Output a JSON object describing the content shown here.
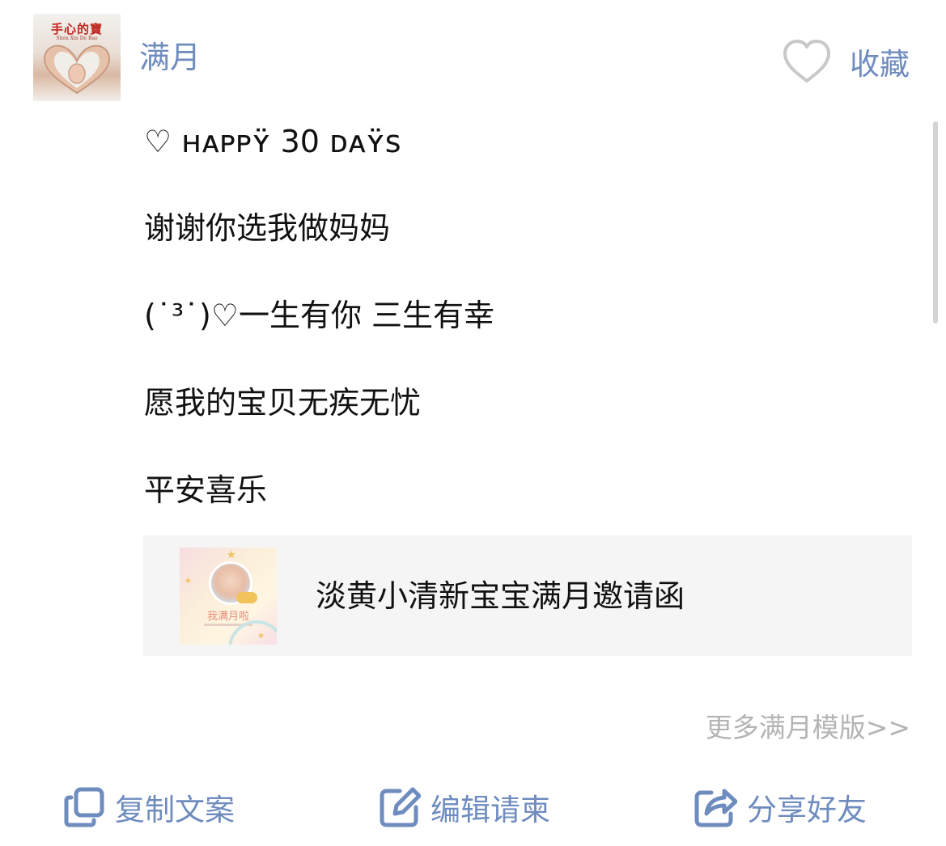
{
  "header": {
    "avatar_logo_text": "手心的寶",
    "avatar_logo_subtext": "Shou Xin De Bao",
    "title": "满月",
    "favorite_label": "收藏"
  },
  "content": {
    "lines": [
      "♡ ʜᴀᴘᴘʏ̈ 30 ᴅᴀʏ̈ѕ",
      "谢谢你选我做妈妈",
      "(˙³˙)♡一生有你 三生有幸",
      "愿我的宝贝无疾无忧",
      "平安喜乐"
    ]
  },
  "template_card": {
    "thumb_label": "我满月啦",
    "title": "淡黄小清新宝宝满月邀请函"
  },
  "more_link": "更多满月模版>>",
  "actions": {
    "copy": "复制文案",
    "edit": "编辑请柬",
    "share": "分享好友"
  },
  "colors": {
    "accent": "#6f8cbf",
    "muted": "#b4b4b4",
    "card_bg": "#f5f5f5",
    "text": "#111111"
  }
}
